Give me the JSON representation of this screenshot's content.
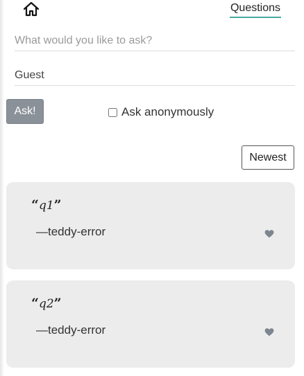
{
  "nav": {
    "home_icon": "home-icon",
    "tab_label": "Questions",
    "tab_underline_color": "#4aa8a0"
  },
  "form": {
    "question_placeholder": "What would you like to ask?",
    "name_value": "Guest",
    "ask_label": "Ask!",
    "anonymous_label": "Ask anonymously",
    "anonymous_checked": false
  },
  "sort": {
    "label": "Newest"
  },
  "questions": [
    {
      "text": "q1",
      "author": "—teddy-error",
      "like_icon": "heart-icon"
    },
    {
      "text": "q2",
      "author": "—teddy-error",
      "like_icon": "heart-icon"
    }
  ],
  "colors": {
    "ask_button_bg": "#8a9199",
    "card_bg": "#ececec",
    "heart": "#7d858e"
  }
}
